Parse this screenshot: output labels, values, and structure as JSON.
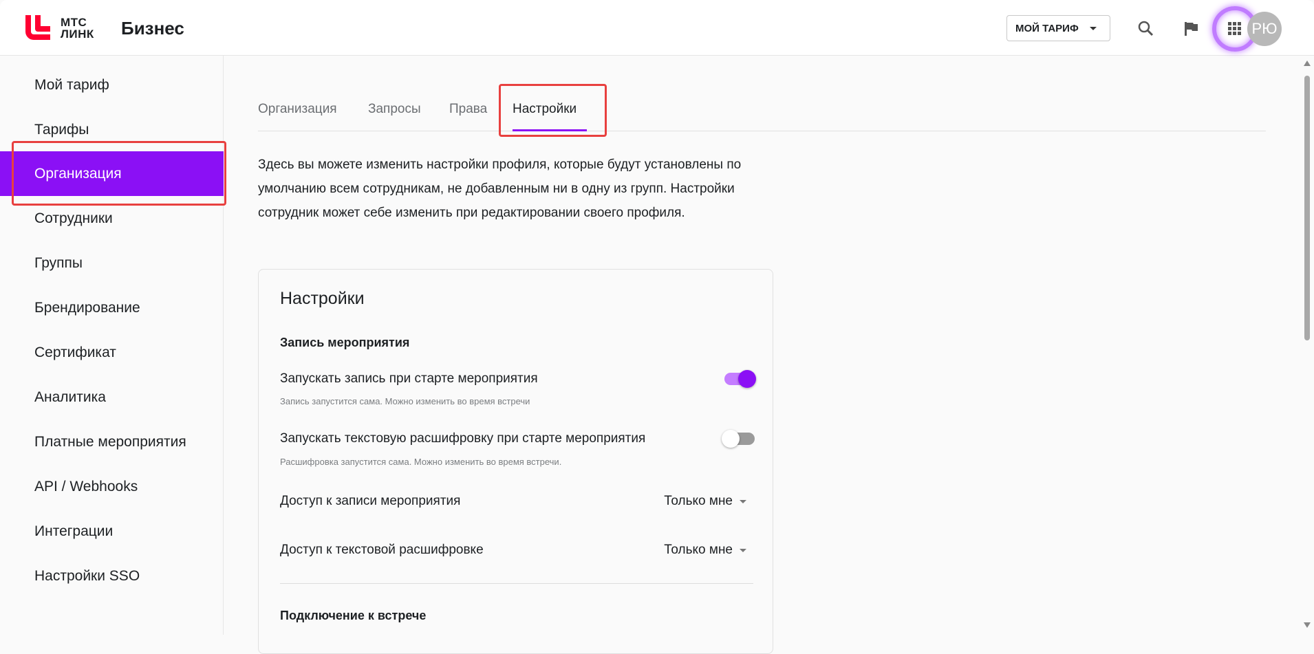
{
  "header": {
    "logo_line1": "МТС",
    "logo_line2": "ЛИНК",
    "brand": "Бизнес",
    "tariff_button": "МОЙ ТАРИФ",
    "avatar_initials": "РЮ",
    "icons": [
      "search-icon",
      "flag-icon",
      "apps-grid-icon"
    ]
  },
  "sidebar": {
    "items": [
      {
        "label": "Мой тариф"
      },
      {
        "label": "Тарифы"
      },
      {
        "label": "Организация",
        "active": true
      },
      {
        "label": "Сотрудники"
      },
      {
        "label": "Группы"
      },
      {
        "label": "Брендирование"
      },
      {
        "label": "Сертификат"
      },
      {
        "label": "Аналитика"
      },
      {
        "label": "Платные мероприятия"
      },
      {
        "label": "API / Webhooks"
      },
      {
        "label": "Интеграции"
      },
      {
        "label": "Настройки SSO"
      }
    ]
  },
  "tabs": [
    {
      "label": "Организация"
    },
    {
      "label": "Запросы"
    },
    {
      "label": "Права"
    },
    {
      "label": "Настройки",
      "active": true
    }
  ],
  "intro": "Здесь вы можете изменить настройки профиля, которые будут установлены по умолчанию всем сотрудникам, не добавленным ни в одну из групп. Настройки сотрудник может себе изменить при редактировании своего профиля.",
  "card": {
    "title": "Настройки",
    "section1": "Запись мероприятия",
    "toggle1": {
      "label": "Запускать запись при старте мероприятия",
      "desc": "Запись запустится сама. Можно изменить во время встречи",
      "on": true
    },
    "toggle2": {
      "label": "Запускать текстовую расшифровку при старте мероприятия",
      "desc": "Расшифровка запустится сама. Можно изменить во время встречи.",
      "on": false
    },
    "select1": {
      "label": "Доступ к записи мероприятия",
      "value": "Только мне"
    },
    "select2": {
      "label": "Доступ к текстовой расшифровке",
      "value": "Только мне"
    },
    "section2": "Подключение к встрече"
  },
  "colors": {
    "accent": "#8b10f5",
    "brand_red": "#ff0032",
    "highlight": "#e8403f"
  }
}
